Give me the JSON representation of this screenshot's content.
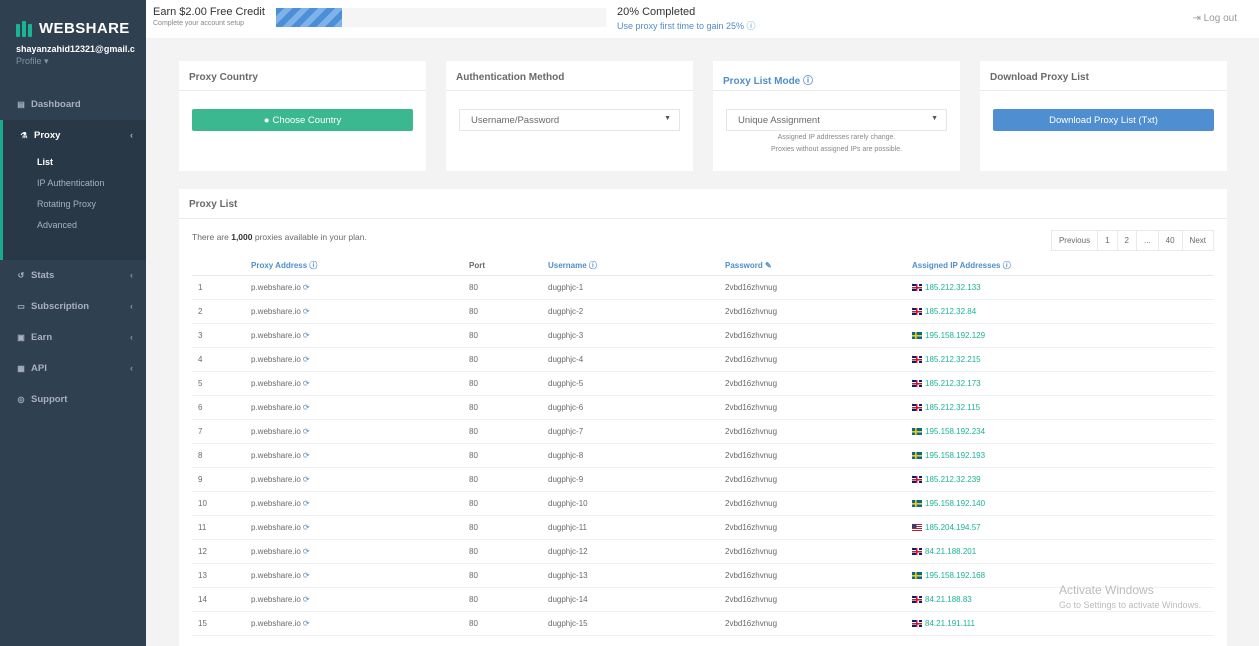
{
  "brand": {
    "name": "WEBSHARE"
  },
  "user": {
    "email": "shayanzahid12321@gmail.c",
    "profile_label": "Profile ▾"
  },
  "nav": {
    "dashboard": "Dashboard",
    "proxy": "Proxy",
    "proxy_sub": [
      "List",
      "IP Authentication",
      "Rotating Proxy",
      "Advanced"
    ],
    "stats": "Stats",
    "subscription": "Subscription",
    "earn": "Earn",
    "api": "API",
    "support": "Support"
  },
  "topbar": {
    "promo_title": "Earn $2.00 Free Credit",
    "promo_sub": "Complete your account setup",
    "progress_percent": 20,
    "progress_label": "20% Completed",
    "progress_link": "Use proxy first time to gain 25% ⓘ",
    "logout": "Log out"
  },
  "cards": {
    "country": {
      "title": "Proxy Country",
      "button": "Choose Country"
    },
    "auth": {
      "title": "Authentication Method",
      "selected": "Username/Password"
    },
    "mode": {
      "title": "Proxy List Mode ⓘ",
      "selected": "Unique Assignment",
      "note1": "Assigned IP addresses rarely change.",
      "note2": "Proxies without assigned IPs are possible."
    },
    "download": {
      "title": "Download Proxy List",
      "button": "Download Proxy List (Txt)"
    }
  },
  "proxy_list": {
    "title": "Proxy List",
    "avail_prefix": "There are ",
    "avail_count": "1,000",
    "avail_suffix": " proxies available in your plan.",
    "pager": [
      "Previous",
      "1",
      "2",
      "...",
      "40",
      "Next"
    ],
    "columns": {
      "address": "Proxy Address ⓘ",
      "port": "Port",
      "username": "Username ⓘ",
      "password": "Password",
      "assigned": "Assigned IP Addresses ⓘ"
    },
    "rows": [
      {
        "no": "1",
        "address": "p.webshare.io",
        "port": "80",
        "username": "dugphjc-1",
        "password": "2vbd16zhvnug",
        "flag": "gb",
        "ip": "185.212.32.133"
      },
      {
        "no": "2",
        "address": "p.webshare.io",
        "port": "80",
        "username": "dugphjc-2",
        "password": "2vbd16zhvnug",
        "flag": "gb",
        "ip": "185.212.32.84"
      },
      {
        "no": "3",
        "address": "p.webshare.io",
        "port": "80",
        "username": "dugphjc-3",
        "password": "2vbd16zhvnug",
        "flag": "se",
        "ip": "195.158.192.129"
      },
      {
        "no": "4",
        "address": "p.webshare.io",
        "port": "80",
        "username": "dugphjc-4",
        "password": "2vbd16zhvnug",
        "flag": "gb",
        "ip": "185.212.32.215"
      },
      {
        "no": "5",
        "address": "p.webshare.io",
        "port": "80",
        "username": "dugphjc-5",
        "password": "2vbd16zhvnug",
        "flag": "gb",
        "ip": "185.212.32.173"
      },
      {
        "no": "6",
        "address": "p.webshare.io",
        "port": "80",
        "username": "dugphjc-6",
        "password": "2vbd16zhvnug",
        "flag": "gb",
        "ip": "185.212.32.115"
      },
      {
        "no": "7",
        "address": "p.webshare.io",
        "port": "80",
        "username": "dugphjc-7",
        "password": "2vbd16zhvnug",
        "flag": "se",
        "ip": "195.158.192.234"
      },
      {
        "no": "8",
        "address": "p.webshare.io",
        "port": "80",
        "username": "dugphjc-8",
        "password": "2vbd16zhvnug",
        "flag": "se",
        "ip": "195.158.192.193"
      },
      {
        "no": "9",
        "address": "p.webshare.io",
        "port": "80",
        "username": "dugphjc-9",
        "password": "2vbd16zhvnug",
        "flag": "gb",
        "ip": "185.212.32.239"
      },
      {
        "no": "10",
        "address": "p.webshare.io",
        "port": "80",
        "username": "dugphjc-10",
        "password": "2vbd16zhvnug",
        "flag": "se",
        "ip": "195.158.192.140"
      },
      {
        "no": "11",
        "address": "p.webshare.io",
        "port": "80",
        "username": "dugphjc-11",
        "password": "2vbd16zhvnug",
        "flag": "us",
        "ip": "185.204.194.57"
      },
      {
        "no": "12",
        "address": "p.webshare.io",
        "port": "80",
        "username": "dugphjc-12",
        "password": "2vbd16zhvnug",
        "flag": "gb",
        "ip": "84.21.188.201"
      },
      {
        "no": "13",
        "address": "p.webshare.io",
        "port": "80",
        "username": "dugphjc-13",
        "password": "2vbd16zhvnug",
        "flag": "se",
        "ip": "195.158.192.168"
      },
      {
        "no": "14",
        "address": "p.webshare.io",
        "port": "80",
        "username": "dugphjc-14",
        "password": "2vbd16zhvnug",
        "flag": "gb",
        "ip": "84.21.188.83"
      },
      {
        "no": "15",
        "address": "p.webshare.io",
        "port": "80",
        "username": "dugphjc-15",
        "password": "2vbd16zhvnug",
        "flag": "gb",
        "ip": "84.21.191.111"
      }
    ]
  },
  "watermark": {
    "line1": "Activate Windows",
    "line2": "Go to Settings to activate Windows."
  },
  "colors": {
    "sidebar": "#2f4050",
    "accent_green": "#1ab394",
    "link_blue": "#4f8ec9",
    "button_blue": "#4f8ed0"
  }
}
